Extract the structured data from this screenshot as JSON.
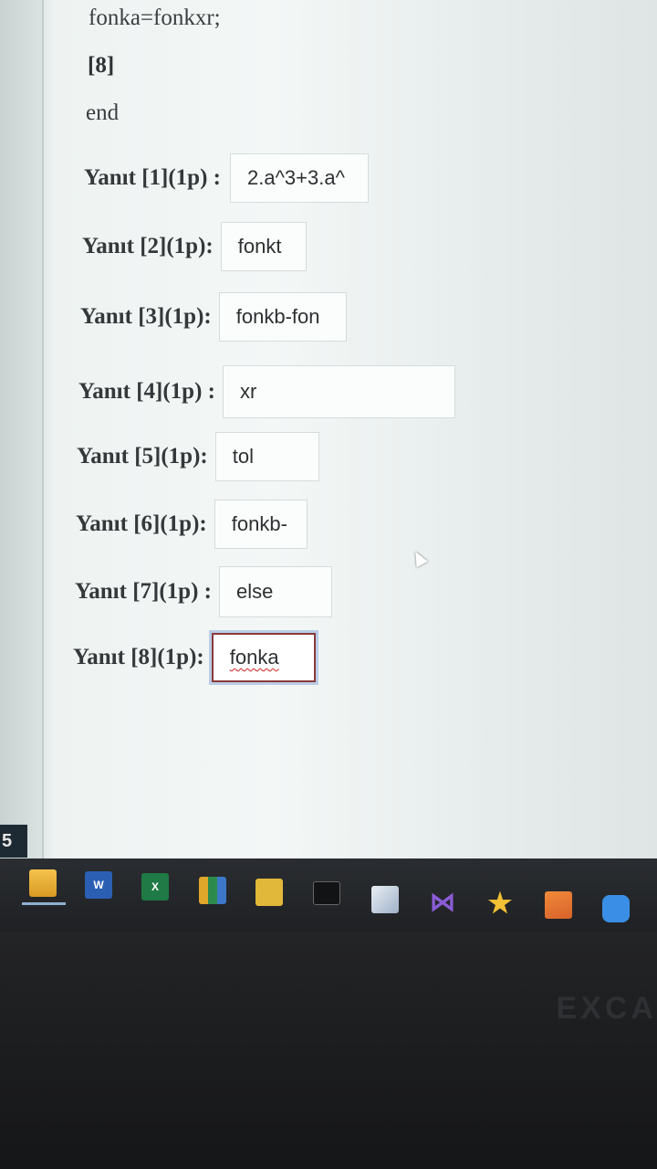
{
  "code": {
    "line1": "fonka=fonkxr;",
    "line2": "[8]",
    "line3": "end"
  },
  "answers": [
    {
      "label": "Yanıt [1](1p) :",
      "value": "2.a^3+3.a^"
    },
    {
      "label": "Yanıt [2](1p):",
      "value": "fonkt"
    },
    {
      "label": "Yanıt [3](1p):",
      "value": "fonkb-fon"
    },
    {
      "label": "Yanıt [4](1p) :",
      "value": "xr"
    },
    {
      "label": "Yanıt [5](1p):",
      "value": "tol"
    },
    {
      "label": "Yanıt [6](1p):",
      "value": "fonkb-"
    },
    {
      "label": "Yanıt [7](1p) :",
      "value": "else"
    },
    {
      "label": "Yanıt [8](1p):",
      "value": "fonka"
    }
  ],
  "side_badge": "5",
  "bezel_text": "EXCA",
  "taskbar": {
    "icons": [
      "folder-icon",
      "word-icon",
      "excel-icon",
      "sheets-icon",
      "photos-icon",
      "terminal-icon",
      "cube-icon",
      "visual-studio-icon",
      "star-icon",
      "sublime-icon",
      "zoom-icon"
    ],
    "word_letter": "W",
    "excel_letter": "X"
  }
}
